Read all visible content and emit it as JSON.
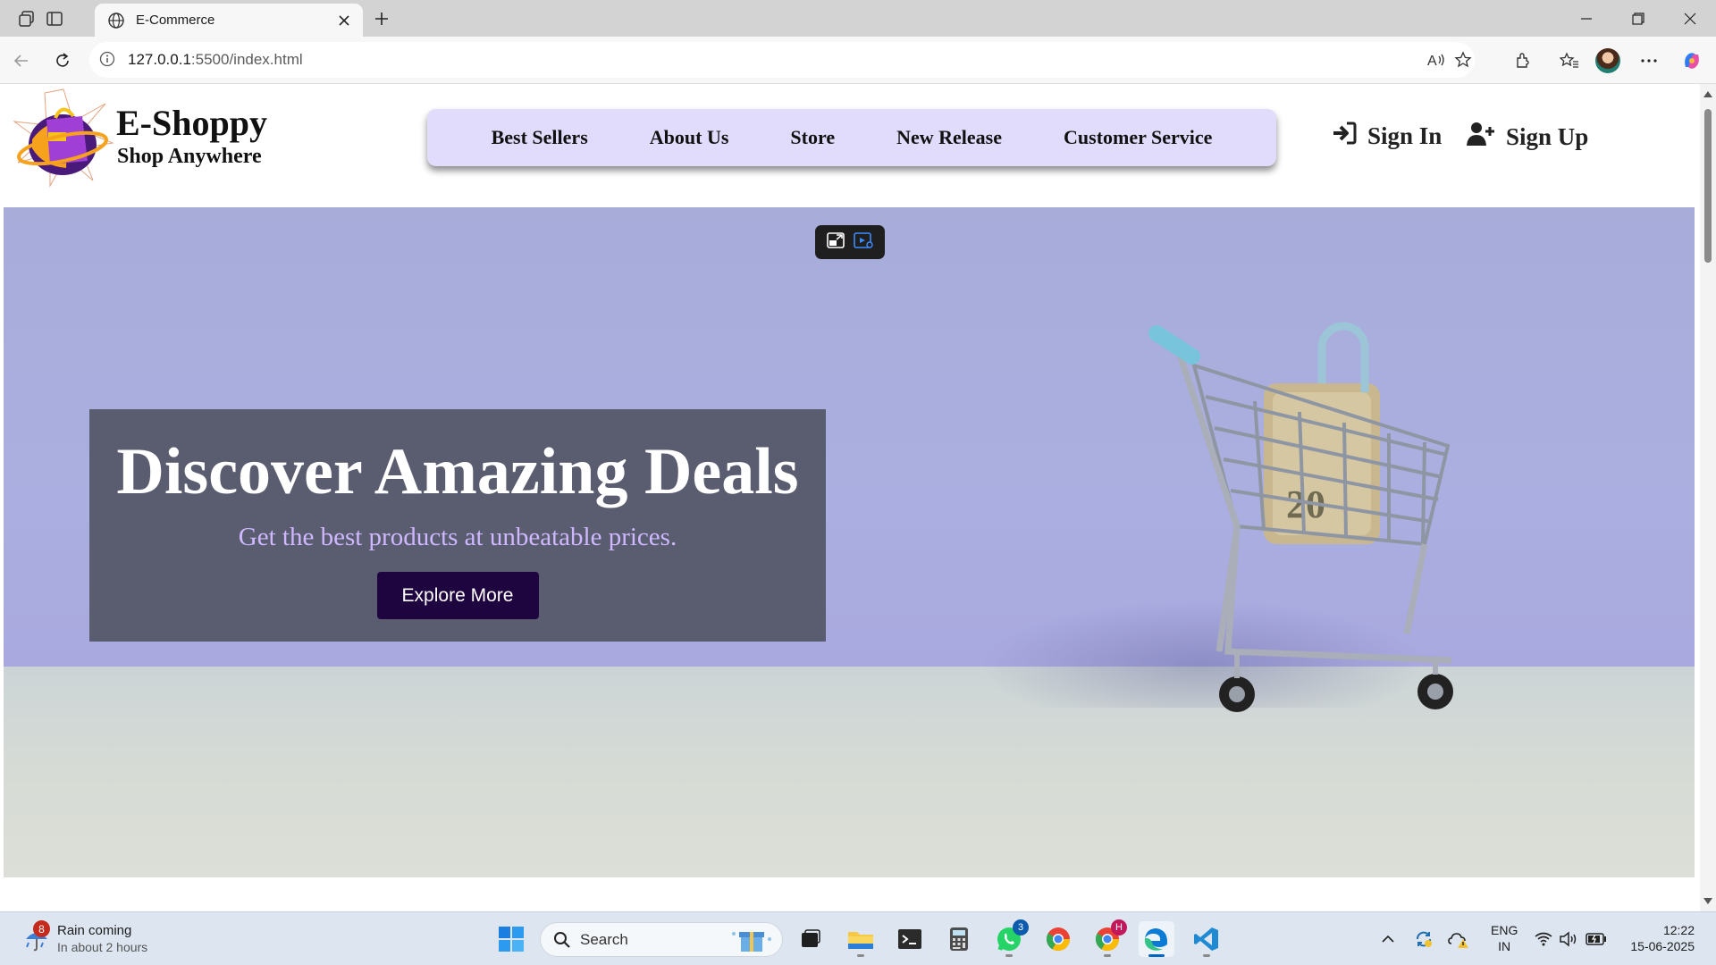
{
  "browser": {
    "tab_title": "E-Commerce",
    "url_host": "127.0.0.1",
    "url_path": ":5500/index.html"
  },
  "site": {
    "brand_title": "E-Shoppy",
    "brand_tagline": "Shop Anywhere",
    "nav": [
      {
        "label": "Best Sellers"
      },
      {
        "label": "About Us"
      },
      {
        "label": "Store"
      },
      {
        "label": "New Release"
      },
      {
        "label": "Customer Service"
      }
    ],
    "auth": {
      "sign_in": "Sign In",
      "sign_up": "Sign Up"
    },
    "hero": {
      "title": "Discover Amazing Deals",
      "subtitle": "Get the best products at unbeatable prices.",
      "cta": "Explore More"
    }
  },
  "taskbar": {
    "weather": {
      "badge": "8",
      "line1": "Rain coming",
      "line2": "In about 2 hours"
    },
    "search_placeholder": "Search",
    "whatsapp_badge": "3",
    "chrome_profile_badge": "H",
    "lang_line1": "ENG",
    "lang_line2": "IN",
    "time": "12:22",
    "date": "15-06-2025"
  },
  "colors": {
    "nav_bg": "#e2dcfc",
    "hero_box": "#5a5c70",
    "cta_bg": "#1f0540",
    "subtitle": "#cfb8ff",
    "edge_accent": "#0067c0"
  }
}
